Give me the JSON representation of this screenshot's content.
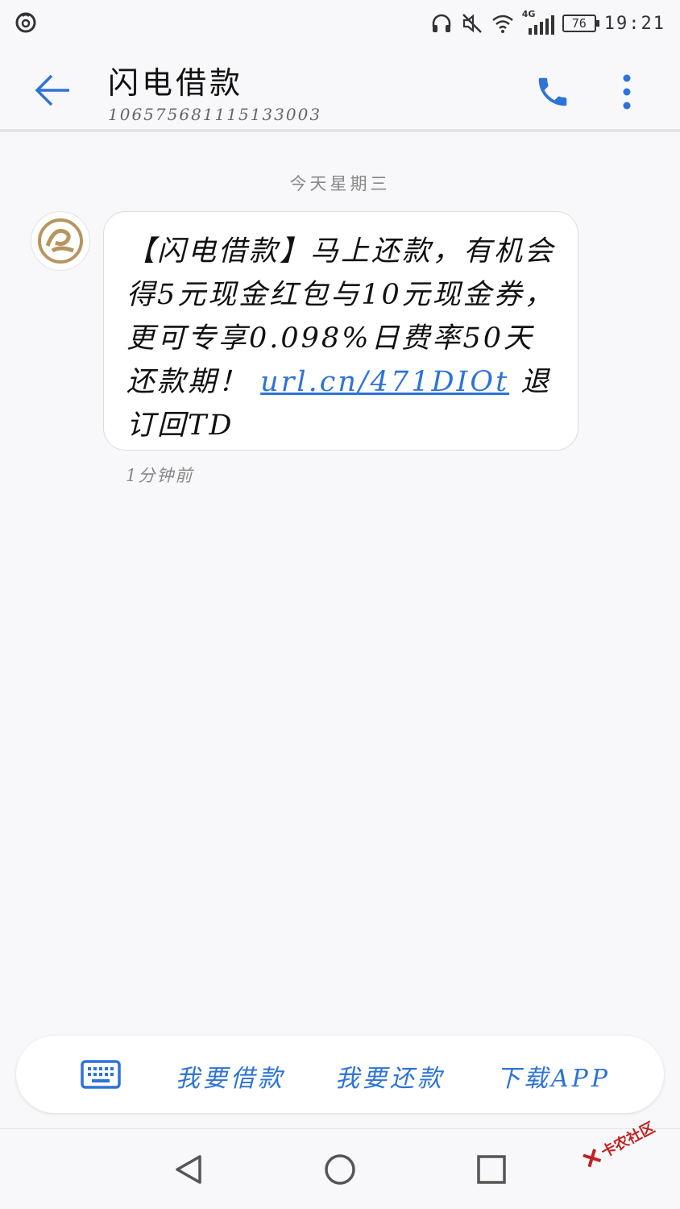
{
  "status_bar": {
    "battery": "76",
    "network": "4G",
    "time": "19:21"
  },
  "header": {
    "title": "闪电借款",
    "number": "106575681115133003"
  },
  "conversation": {
    "date_separator": "今天星期三",
    "message_text": "【闪电借款】马上还款，有机会得5元现金红包与10元现金券，更可专享0.098%日费率50天还款期！",
    "message_link": "url.cn/471DIOt",
    "message_suffix": " 退订回TD",
    "time_ago": "1分钟前"
  },
  "menu": {
    "items": [
      {
        "label": "我要借款"
      },
      {
        "label": "我要还款"
      },
      {
        "label": "下载APP"
      }
    ]
  },
  "watermark": {
    "text": "卡农社区"
  },
  "colors": {
    "accent": "#2d73d8",
    "background": "#f8f8fa",
    "avatar_gold": "#b8955e",
    "watermark": "#c32020"
  }
}
